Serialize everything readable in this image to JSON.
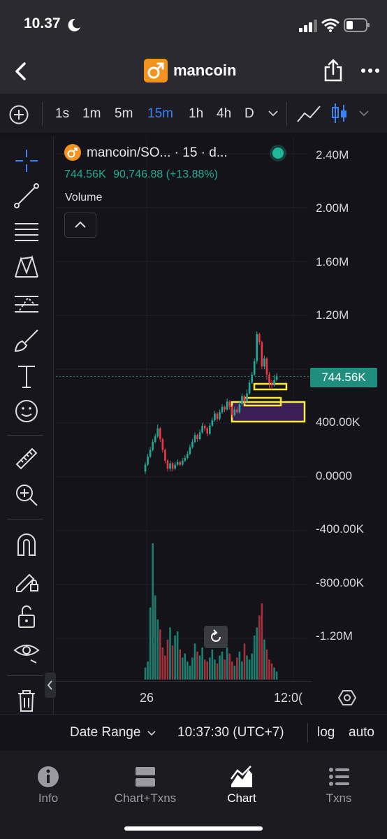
{
  "status": {
    "time": "10.37"
  },
  "header": {
    "title": "mancoin"
  },
  "timeframes": [
    {
      "label": "1s",
      "active": false
    },
    {
      "label": "1m",
      "active": false
    },
    {
      "label": "5m",
      "active": false
    },
    {
      "label": "15m",
      "active": true
    },
    {
      "label": "1h",
      "active": false
    },
    {
      "label": "4h",
      "active": false
    },
    {
      "label": "D",
      "active": false
    }
  ],
  "legend": {
    "title": "mancoin/SO... · 15 · d...",
    "price": "744.56K",
    "change": "90,746.88 (+13.88%)",
    "volume_label": "Volume"
  },
  "price_axis": [
    "2.40M",
    "2.00M",
    "1.60M",
    "1.20M",
    "400.00K",
    "0.0000",
    "-400.00K",
    "-800.00K",
    "-1.20M"
  ],
  "current_price_label": "744.56K",
  "time_axis": [
    "26",
    "12:0("
  ],
  "bottom_bar": {
    "date_range": "Date Range",
    "clock": "10:37:30 (UTC+7)",
    "log": "log",
    "auto": "auto"
  },
  "tabs": [
    {
      "label": "Info",
      "icon": "info-icon",
      "active": false
    },
    {
      "label": "Chart+Txns",
      "icon": "split-view-icon",
      "active": false
    },
    {
      "label": "Chart",
      "icon": "chart-icon",
      "active": true
    },
    {
      "label": "Txns",
      "icon": "list-icon",
      "active": false
    }
  ],
  "colors": {
    "up": "#22ab94",
    "down": "#f23645",
    "accent": "#3b82f6",
    "highlight": "#ffeb3b",
    "coin": "#f4921f"
  },
  "chart_data": {
    "type": "candlestick",
    "y_unit_scale": "thousands",
    "ylim": [
      -1300,
      2500
    ],
    "current_price": 744.56,
    "candles": [
      {
        "o": 40,
        "c": 90,
        "h": 110,
        "l": 20
      },
      {
        "o": 90,
        "c": 150,
        "h": 170,
        "l": 80
      },
      {
        "o": 150,
        "c": 200,
        "h": 220,
        "l": 140
      },
      {
        "o": 200,
        "c": 260,
        "h": 280,
        "l": 190
      },
      {
        "o": 260,
        "c": 300,
        "h": 320,
        "l": 250
      },
      {
        "o": 300,
        "c": 360,
        "h": 390,
        "l": 290
      },
      {
        "o": 360,
        "c": 280,
        "h": 370,
        "l": 260
      },
      {
        "o": 280,
        "c": 200,
        "h": 290,
        "l": 180
      },
      {
        "o": 200,
        "c": 120,
        "h": 210,
        "l": 100
      },
      {
        "o": 120,
        "c": 60,
        "h": 130,
        "l": 40
      },
      {
        "o": 60,
        "c": 100,
        "h": 120,
        "l": 40
      },
      {
        "o": 100,
        "c": 60,
        "h": 110,
        "l": 40
      },
      {
        "o": 60,
        "c": 90,
        "h": 110,
        "l": 50
      },
      {
        "o": 90,
        "c": 110,
        "h": 130,
        "l": 80
      },
      {
        "o": 110,
        "c": 90,
        "h": 120,
        "l": 80
      },
      {
        "o": 90,
        "c": 120,
        "h": 140,
        "l": 80
      },
      {
        "o": 120,
        "c": 140,
        "h": 160,
        "l": 110
      },
      {
        "o": 140,
        "c": 170,
        "h": 190,
        "l": 130
      },
      {
        "o": 170,
        "c": 220,
        "h": 240,
        "l": 160
      },
      {
        "o": 220,
        "c": 260,
        "h": 280,
        "l": 210
      },
      {
        "o": 260,
        "c": 310,
        "h": 330,
        "l": 250
      },
      {
        "o": 310,
        "c": 280,
        "h": 320,
        "l": 260
      },
      {
        "o": 280,
        "c": 330,
        "h": 350,
        "l": 270
      },
      {
        "o": 330,
        "c": 380,
        "h": 400,
        "l": 320
      },
      {
        "o": 380,
        "c": 360,
        "h": 390,
        "l": 340
      },
      {
        "o": 360,
        "c": 320,
        "h": 370,
        "l": 300
      },
      {
        "o": 320,
        "c": 380,
        "h": 400,
        "l": 310
      },
      {
        "o": 380,
        "c": 420,
        "h": 440,
        "l": 370
      },
      {
        "o": 420,
        "c": 470,
        "h": 490,
        "l": 410
      },
      {
        "o": 470,
        "c": 430,
        "h": 480,
        "l": 410
      },
      {
        "o": 430,
        "c": 480,
        "h": 500,
        "l": 420
      },
      {
        "o": 480,
        "c": 520,
        "h": 540,
        "l": 470
      },
      {
        "o": 520,
        "c": 500,
        "h": 530,
        "l": 480
      },
      {
        "o": 500,
        "c": 560,
        "h": 580,
        "l": 490
      },
      {
        "o": 560,
        "c": 520,
        "h": 570,
        "l": 500
      },
      {
        "o": 520,
        "c": 460,
        "h": 530,
        "l": 440
      },
      {
        "o": 460,
        "c": 500,
        "h": 520,
        "l": 450
      },
      {
        "o": 500,
        "c": 480,
        "h": 520,
        "l": 470
      },
      {
        "o": 480,
        "c": 540,
        "h": 560,
        "l": 470
      },
      {
        "o": 540,
        "c": 600,
        "h": 620,
        "l": 530
      },
      {
        "o": 600,
        "c": 560,
        "h": 610,
        "l": 540
      },
      {
        "o": 560,
        "c": 620,
        "h": 650,
        "l": 550
      },
      {
        "o": 620,
        "c": 700,
        "h": 720,
        "l": 610
      },
      {
        "o": 700,
        "c": 760,
        "h": 780,
        "l": 690
      },
      {
        "o": 760,
        "c": 860,
        "h": 880,
        "l": 750
      },
      {
        "o": 860,
        "c": 1060,
        "h": 1080,
        "l": 840
      },
      {
        "o": 1060,
        "c": 1000,
        "h": 1070,
        "l": 980
      },
      {
        "o": 1000,
        "c": 820,
        "h": 1010,
        "l": 800
      },
      {
        "o": 820,
        "c": 880,
        "h": 900,
        "l": 800
      },
      {
        "o": 880,
        "c": 760,
        "h": 890,
        "l": 720
      },
      {
        "o": 760,
        "c": 700,
        "h": 780,
        "l": 660
      },
      {
        "o": 700,
        "c": 680,
        "h": 720,
        "l": 650
      },
      {
        "o": 680,
        "c": 720,
        "h": 760,
        "l": 670
      },
      {
        "o": 720,
        "c": 750,
        "h": 770,
        "l": 710
      }
    ],
    "volumes": [
      60,
      90,
      360,
      680,
      420,
      300,
      250,
      160,
      120,
      200,
      260,
      170,
      220,
      240,
      150,
      110,
      130,
      90,
      70,
      110,
      180,
      140,
      120,
      160,
      100,
      90,
      110,
      150,
      100,
      80,
      120,
      140,
      100,
      160,
      130,
      90,
      70,
      110,
      140,
      90,
      180,
      120,
      100,
      130,
      220,
      260,
      320,
      380,
      200,
      150,
      100,
      80,
      60,
      40
    ]
  }
}
